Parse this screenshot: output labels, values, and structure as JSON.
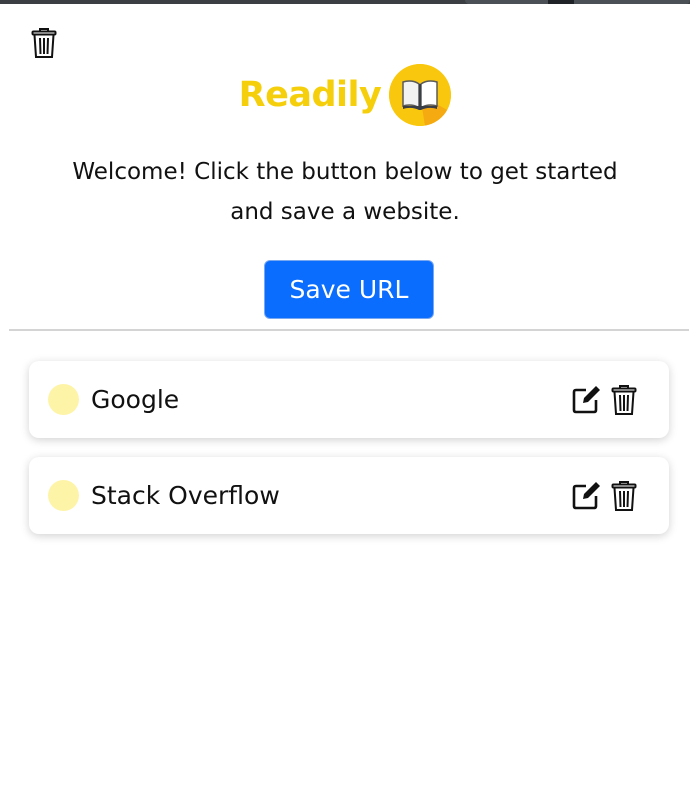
{
  "app": {
    "brand_name": "Readily",
    "brand_color": "#f5cf0c",
    "logo_icon": "book-icon"
  },
  "header": {
    "clear_all_icon": "trash-icon"
  },
  "intro": {
    "welcome_text": "Welcome! Click the button below to get started and save a website."
  },
  "actions": {
    "save_label": "Save URL",
    "save_color": "#0b6dfd"
  },
  "saved_sites": [
    {
      "title": "Google",
      "status_color": "#fdf4a8",
      "edit_icon": "edit-icon",
      "delete_icon": "trash-icon"
    },
    {
      "title": "Stack Overflow",
      "status_color": "#fdf4a8",
      "edit_icon": "edit-icon",
      "delete_icon": "trash-icon"
    }
  ]
}
